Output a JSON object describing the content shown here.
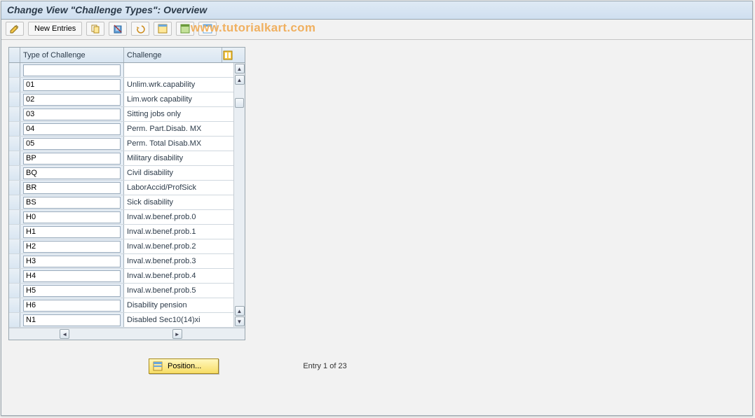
{
  "title": "Change View \"Challenge Types\": Overview",
  "toolbar": {
    "new_entries_label": "New Entries"
  },
  "watermark": "www.tutorialkart.com",
  "table": {
    "headers": {
      "type": "Type of Challenge",
      "challenge": "Challenge"
    },
    "rows": [
      {
        "type": "",
        "challenge": ""
      },
      {
        "type": "01",
        "challenge": "Unlim.wrk.capability"
      },
      {
        "type": "02",
        "challenge": "Lim.work capability"
      },
      {
        "type": "03",
        "challenge": "Sitting jobs only"
      },
      {
        "type": "04",
        "challenge": "Perm. Part.Disab. MX"
      },
      {
        "type": "05",
        "challenge": "Perm. Total Disab.MX"
      },
      {
        "type": "BP",
        "challenge": "Military disability"
      },
      {
        "type": "BQ",
        "challenge": "Civil disability"
      },
      {
        "type": "BR",
        "challenge": "LaborAccid/ProfSick"
      },
      {
        "type": "BS",
        "challenge": "Sick disability"
      },
      {
        "type": "H0",
        "challenge": "Inval.w.benef.prob.0"
      },
      {
        "type": "H1",
        "challenge": "Inval.w.benef.prob.1"
      },
      {
        "type": "H2",
        "challenge": "Inval.w.benef.prob.2"
      },
      {
        "type": "H3",
        "challenge": "Inval.w.benef.prob.3"
      },
      {
        "type": "H4",
        "challenge": "Inval.w.benef.prob.4"
      },
      {
        "type": "H5",
        "challenge": "Inval.w.benef.prob.5"
      },
      {
        "type": "H6",
        "challenge": "Disability pension"
      },
      {
        "type": "N1",
        "challenge": "Disabled Sec10(14)xi"
      }
    ]
  },
  "footer": {
    "position_label": "Position...",
    "entry_text": "Entry 1 of 23"
  }
}
